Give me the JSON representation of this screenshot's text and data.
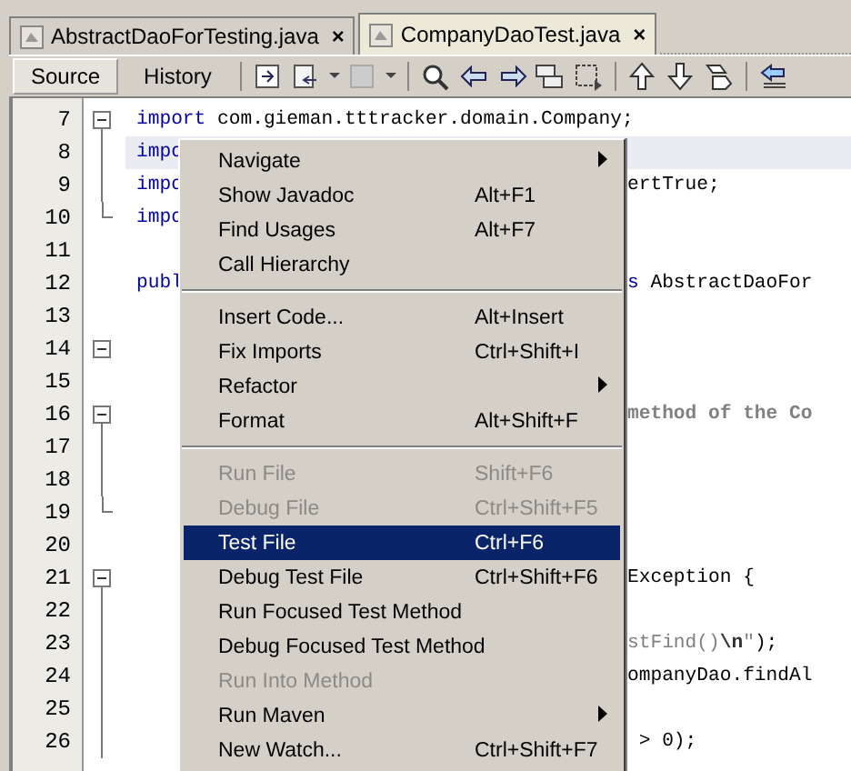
{
  "tabs": [
    {
      "label": "AbstractDaoForTesting.java",
      "close": "×",
      "selected": false
    },
    {
      "label": "CompanyDaoTest.java",
      "close": "×",
      "selected": true
    }
  ],
  "toolbar": {
    "views": [
      {
        "label": "Source",
        "selected": true
      },
      {
        "label": "History",
        "selected": false
      }
    ]
  },
  "editor": {
    "lines": [
      {
        "number": "7",
        "kind": "fold_start",
        "left": [
          {
            "text": "import",
            "kind": "keyword"
          },
          {
            "text": " com.gieman.tttracker.domain.Company;",
            "kind": "plain"
          }
        ]
      },
      {
        "number": "8",
        "kind": "fold_line",
        "highlighted": true,
        "left": [
          {
            "text": "impo",
            "kind": "keyword"
          }
        ]
      },
      {
        "number": "9",
        "kind": "fold_line",
        "left": [
          {
            "text": "impo",
            "kind": "keyword"
          }
        ],
        "right": [
          {
            "text": "ertTrue;",
            "kind": "plain"
          }
        ]
      },
      {
        "number": "10",
        "kind": "fold_end",
        "left": [
          {
            "text": "impo",
            "kind": "keyword"
          }
        ]
      },
      {
        "number": "11",
        "kind": "plain"
      },
      {
        "number": "12",
        "kind": "plain",
        "left": [
          {
            "text": "publ",
            "kind": "keyword"
          }
        ],
        "right": [
          {
            "text": "s",
            "kind": "keyword"
          },
          {
            "text": " AbstractDaoFor",
            "kind": "plain"
          }
        ]
      },
      {
        "number": "13",
        "kind": "plain"
      },
      {
        "number": "14",
        "kind": "fold_box"
      },
      {
        "number": "15",
        "kind": "plain"
      },
      {
        "number": "16",
        "kind": "fold_start",
        "right": [
          {
            "text": "method of the Co",
            "kind": "comment"
          }
        ]
      },
      {
        "number": "17",
        "kind": "fold_line"
      },
      {
        "number": "18",
        "kind": "fold_line"
      },
      {
        "number": "19",
        "kind": "fold_end"
      },
      {
        "number": "20",
        "kind": "plain"
      },
      {
        "number": "21",
        "kind": "fold_start",
        "right": [
          {
            "text": "Exception {",
            "kind": "plain"
          }
        ]
      },
      {
        "number": "22",
        "kind": "fold_line"
      },
      {
        "number": "23",
        "kind": "fold_line",
        "right": [
          {
            "text": "stFind()",
            "kind": "string"
          },
          {
            "text": "\\n",
            "kind": "escape"
          },
          {
            "text": "\"",
            "kind": "string"
          },
          {
            "text": ");",
            "kind": "plain"
          }
        ]
      },
      {
        "number": "24",
        "kind": "fold_line",
        "right": [
          {
            "text": "ompanyDao.findAl",
            "kind": "plain"
          }
        ]
      },
      {
        "number": "25",
        "kind": "fold_line"
      },
      {
        "number": "26",
        "kind": "fold_line",
        "right": [
          {
            "text": " > 0);",
            "kind": "plain"
          }
        ]
      }
    ]
  },
  "context_menu": {
    "groups": [
      [
        {
          "label": "Navigate",
          "submenu": true,
          "disabled": false,
          "selected": false
        },
        {
          "label": "Show Javadoc",
          "shortcut": "Alt+F1",
          "submenu": false,
          "disabled": false,
          "selected": false
        },
        {
          "label": "Find Usages",
          "shortcut": "Alt+F7",
          "submenu": false,
          "disabled": false,
          "selected": false
        },
        {
          "label": "Call Hierarchy",
          "submenu": false,
          "disabled": false,
          "selected": false
        }
      ],
      [
        {
          "label": "Insert Code...",
          "shortcut": "Alt+Insert",
          "submenu": false,
          "disabled": false,
          "selected": false
        },
        {
          "label": "Fix Imports",
          "shortcut": "Ctrl+Shift+I",
          "submenu": false,
          "disabled": false,
          "selected": false
        },
        {
          "label": "Refactor",
          "submenu": true,
          "disabled": false,
          "selected": false
        },
        {
          "label": "Format",
          "shortcut": "Alt+Shift+F",
          "submenu": false,
          "disabled": false,
          "selected": false
        }
      ],
      [
        {
          "label": "Run File",
          "shortcut": "Shift+F6",
          "submenu": false,
          "disabled": true,
          "selected": false
        },
        {
          "label": "Debug File",
          "shortcut": "Ctrl+Shift+F5",
          "submenu": false,
          "disabled": true,
          "selected": false
        },
        {
          "label": "Test File",
          "shortcut": "Ctrl+F6",
          "submenu": false,
          "disabled": false,
          "selected": true
        },
        {
          "label": "Debug Test File",
          "shortcut": "Ctrl+Shift+F6",
          "submenu": false,
          "disabled": false,
          "selected": false
        },
        {
          "label": "Run Focused Test Method",
          "submenu": false,
          "disabled": false,
          "selected": false
        },
        {
          "label": "Debug Focused Test Method",
          "submenu": false,
          "disabled": false,
          "selected": false
        },
        {
          "label": "Run Into Method",
          "submenu": false,
          "disabled": true,
          "selected": false
        },
        {
          "label": "Run Maven",
          "submenu": true,
          "disabled": false,
          "selected": false
        },
        {
          "label": "New Watch...",
          "shortcut": "Ctrl+Shift+F7",
          "submenu": false,
          "disabled": false,
          "selected": false
        }
      ]
    ]
  }
}
